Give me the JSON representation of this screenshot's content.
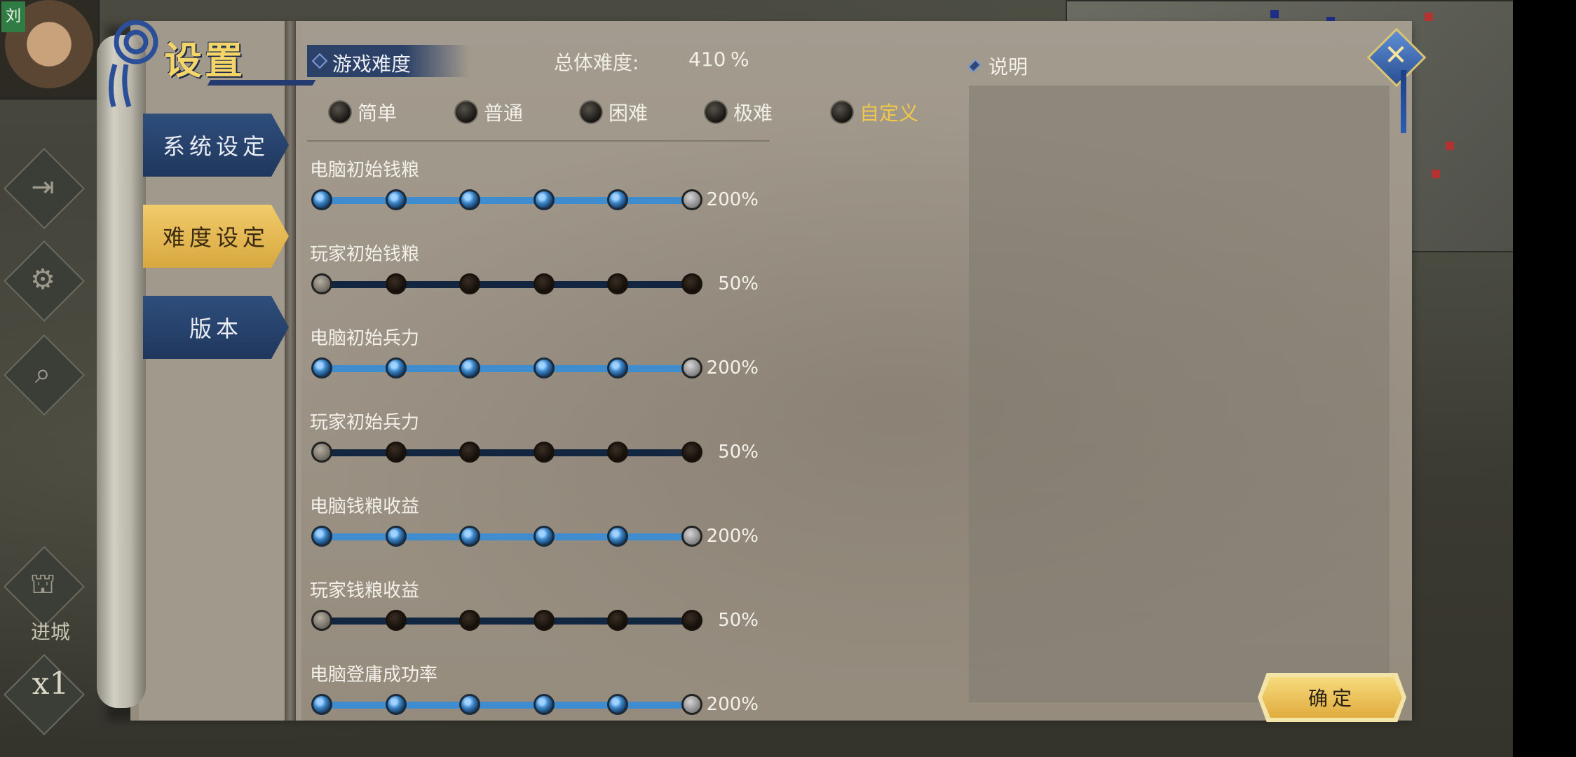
{
  "background": {
    "portrait_tag": "刘",
    "enter_city_label": "进城",
    "speed_label": "x1"
  },
  "dialog": {
    "title": "设置",
    "nav": [
      {
        "label": "系统设定",
        "state": "inactive"
      },
      {
        "label": "难度设定",
        "state": "active"
      },
      {
        "label": "版本",
        "state": "inactive"
      }
    ],
    "difficulty": {
      "section_title": "游戏难度",
      "overall_label": "总体难度:",
      "overall_value": "410",
      "overall_unit": "%",
      "presets": [
        {
          "label": "简单",
          "selected": false
        },
        {
          "label": "普通",
          "selected": false
        },
        {
          "label": "困难",
          "selected": false
        },
        {
          "label": "极难",
          "selected": false
        },
        {
          "label": "自定义",
          "selected": true
        }
      ],
      "sliders": [
        {
          "label": "电脑初始钱粮",
          "value": "200%",
          "level": 5,
          "steps": 5
        },
        {
          "label": "玩家初始钱粮",
          "value": "50%",
          "level": 0,
          "steps": 5
        },
        {
          "label": "电脑初始兵力",
          "value": "200%",
          "level": 5,
          "steps": 5
        },
        {
          "label": "玩家初始兵力",
          "value": "50%",
          "level": 0,
          "steps": 5
        },
        {
          "label": "电脑钱粮收益",
          "value": "200%",
          "level": 5,
          "steps": 5
        },
        {
          "label": "玩家钱粮收益",
          "value": "50%",
          "level": 0,
          "steps": 5
        },
        {
          "label": "电脑登庸成功率",
          "value": "200%",
          "level": 5,
          "steps": 5
        }
      ]
    },
    "description": {
      "title": "说明",
      "text": ""
    },
    "confirm_label": "确定",
    "close_label": "✕"
  },
  "colors": {
    "accent_gold": "#f1c84a",
    "nav_blue": "#2f4e7c",
    "slider_on": "#3f8ccf",
    "slider_track": "#12273f"
  }
}
